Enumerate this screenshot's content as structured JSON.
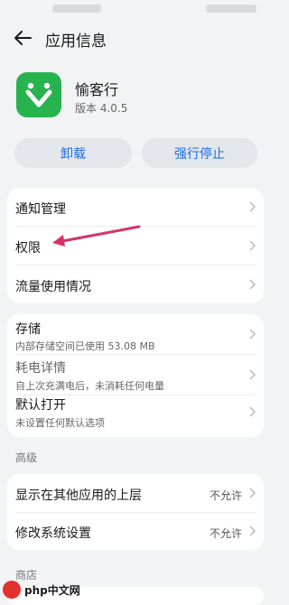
{
  "header": {
    "title": "应用信息"
  },
  "app": {
    "name": "愉客行",
    "version": "版本 4.0.5"
  },
  "actions": {
    "uninstall": "卸载",
    "force_stop": "强行停止"
  },
  "group1": [
    {
      "label": "通知管理"
    },
    {
      "label": "权限"
    },
    {
      "label": "流量使用情况"
    }
  ],
  "group2": {
    "storage": {
      "label": "存储",
      "sub": "内部存储空间已使用 53.08 MB"
    },
    "battery": {
      "label": "耗电详情",
      "sub": "自上次充满电后，未消耗任何电量"
    },
    "default_open": {
      "label": "默认打开",
      "sub": "未设置任何默认选项"
    }
  },
  "advanced": {
    "header": "高级",
    "items": [
      {
        "label": "显示在其他应用的上层",
        "value": "不允许"
      },
      {
        "label": "修改系统设置",
        "value": "不允许"
      }
    ]
  },
  "store": {
    "header": "商店"
  },
  "watermark": {
    "text": "php中文网"
  },
  "colors": {
    "accent": "#1a6ee6",
    "annotation_arrow": "#d6336c",
    "app_icon": "#27b34e"
  }
}
